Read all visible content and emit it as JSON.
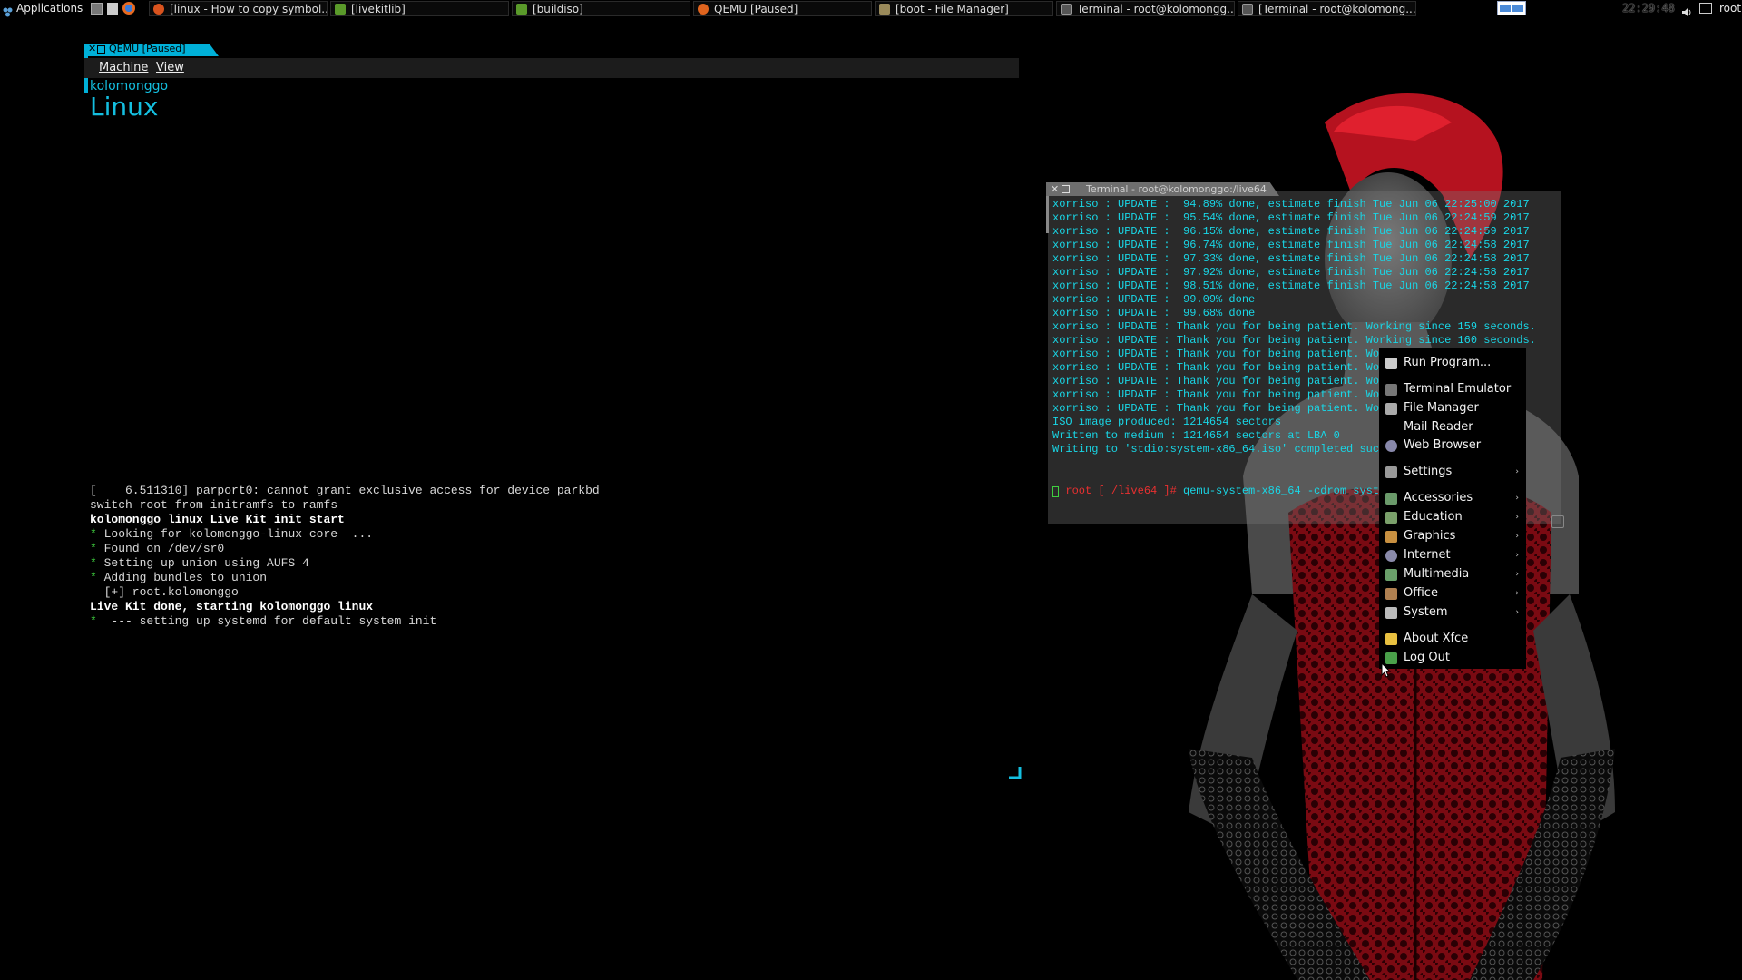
{
  "taskbar": {
    "applications_label": "Applications",
    "tasks": [
      {
        "label": "[linux - How to copy symbol...",
        "color": "#d9531e"
      },
      {
        "label": "[livekitlib]",
        "color": "#5a9a2a"
      },
      {
        "label": "[buildiso]",
        "color": "#5a9a2a"
      },
      {
        "label": "QEMU [Paused]",
        "color": "#e0641e"
      },
      {
        "label": "[boot - File Manager]",
        "color": "#9a8a5a"
      },
      {
        "label": "Terminal - root@kolomongg...",
        "color": "#555555"
      },
      {
        "label": "[Terminal - root@kolomong...",
        "color": "#555555"
      }
    ],
    "clock": "22:29:48",
    "user": "root"
  },
  "qemu": {
    "title": "QEMU [Paused]",
    "menu": [
      "Machine",
      "View"
    ],
    "splash_small": "kolomonggo",
    "splash_big": "Linux",
    "console": [
      {
        "t": "[    6.511310] parport0: cannot grant exclusive access for device parkbd",
        "s": "n"
      },
      {
        "t": "switch root from initramfs to ramfs",
        "s": "n"
      },
      {
        "t": "kolomonggo linux Live Kit init start",
        "s": "b"
      },
      {
        "t": "Looking for kolomonggo-linux core  ...",
        "s": "star"
      },
      {
        "t": "Found on /dev/sr0",
        "s": "star"
      },
      {
        "t": "Setting up union using AUFS 4",
        "s": "star"
      },
      {
        "t": "Adding bundles to union",
        "s": "star"
      },
      {
        "t": "  [+] root.kolomonggo",
        "s": "n"
      },
      {
        "t": "Live Kit done, starting kolomonggo linux",
        "s": "b"
      },
      {
        "t": " --- setting up systemd for default system init",
        "s": "star"
      }
    ]
  },
  "terminal": {
    "title": "Terminal - root@kolomonggo:/live64",
    "lines": [
      "xorriso : UPDATE :  94.89% done, estimate finish Tue Jun 06 22:25:00 2017",
      "xorriso : UPDATE :  95.54% done, estimate finish Tue Jun 06 22:24:59 2017",
      "xorriso : UPDATE :  96.15% done, estimate finish Tue Jun 06 22:24:59 2017",
      "xorriso : UPDATE :  96.74% done, estimate finish Tue Jun 06 22:24:58 2017",
      "xorriso : UPDATE :  97.33% done, estimate finish Tue Jun 06 22:24:58 2017",
      "xorriso : UPDATE :  97.92% done, estimate finish Tue Jun 06 22:24:58 2017",
      "xorriso : UPDATE :  98.51% done, estimate finish Tue Jun 06 22:24:58 2017",
      "xorriso : UPDATE :  99.09% done",
      "xorriso : UPDATE :  99.68% done",
      "xorriso : UPDATE : Thank you for being patient. Working since 159 seconds.",
      "xorriso : UPDATE : Thank you for being patient. Working since 160 seconds.",
      "xorriso : UPDATE : Thank you for being patient. Worki",
      "xorriso : UPDATE : Thank you for being patient. Worki",
      "xorriso : UPDATE : Thank you for being patient. Worki",
      "xorriso : UPDATE : Thank you for being patient. Worki",
      "xorriso : UPDATE : Thank you for being patient. Worki",
      "ISO image produced: 1214654 sectors",
      "Written to medium : 1214654 sectors at LBA 0",
      "Writing to 'stdio:system-x86_64.iso' completed succe"
    ],
    "prompt": "root [ /live64 ]#",
    "command": " qemu-system-x86_64 -cdrom system-x"
  },
  "menu": {
    "items": [
      {
        "label": "Run Program...",
        "icon": "run-icon",
        "sub": false,
        "color": "#cccccc"
      },
      {
        "label": "Terminal Emulator",
        "icon": "terminal-icon",
        "sub": false,
        "color": "#777777"
      },
      {
        "label": "File Manager",
        "icon": "file-manager-icon",
        "sub": false,
        "color": "#aaaaaa"
      },
      {
        "label": "Mail Reader",
        "icon": "",
        "sub": false,
        "color": ""
      },
      {
        "label": "Web Browser",
        "icon": "web-browser-icon",
        "sub": false,
        "color": "#8888aa"
      },
      {
        "label": "Settings",
        "icon": "settings-icon",
        "sub": true,
        "color": "#999999"
      },
      {
        "label": "Accessories",
        "icon": "accessories-icon",
        "sub": true,
        "color": "#6a9a6a"
      },
      {
        "label": "Education",
        "icon": "education-icon",
        "sub": true,
        "color": "#7aa06a"
      },
      {
        "label": "Graphics",
        "icon": "graphics-icon",
        "sub": true,
        "color": "#c89040"
      },
      {
        "label": "Internet",
        "icon": "internet-icon",
        "sub": true,
        "color": "#8a8aaa"
      },
      {
        "label": "Multimedia",
        "icon": "multimedia-icon",
        "sub": true,
        "color": "#6aa06a"
      },
      {
        "label": "Office",
        "icon": "office-icon",
        "sub": true,
        "color": "#b08050"
      },
      {
        "label": "System",
        "icon": "system-icon",
        "sub": true,
        "color": "#bbbbbb"
      },
      {
        "label": "About Xfce",
        "icon": "about-icon",
        "sub": false,
        "color": "#e8c040"
      },
      {
        "label": "Log Out",
        "icon": "logout-icon",
        "sub": false,
        "color": "#4aa04a"
      }
    ],
    "arrow_glyph": "›"
  }
}
